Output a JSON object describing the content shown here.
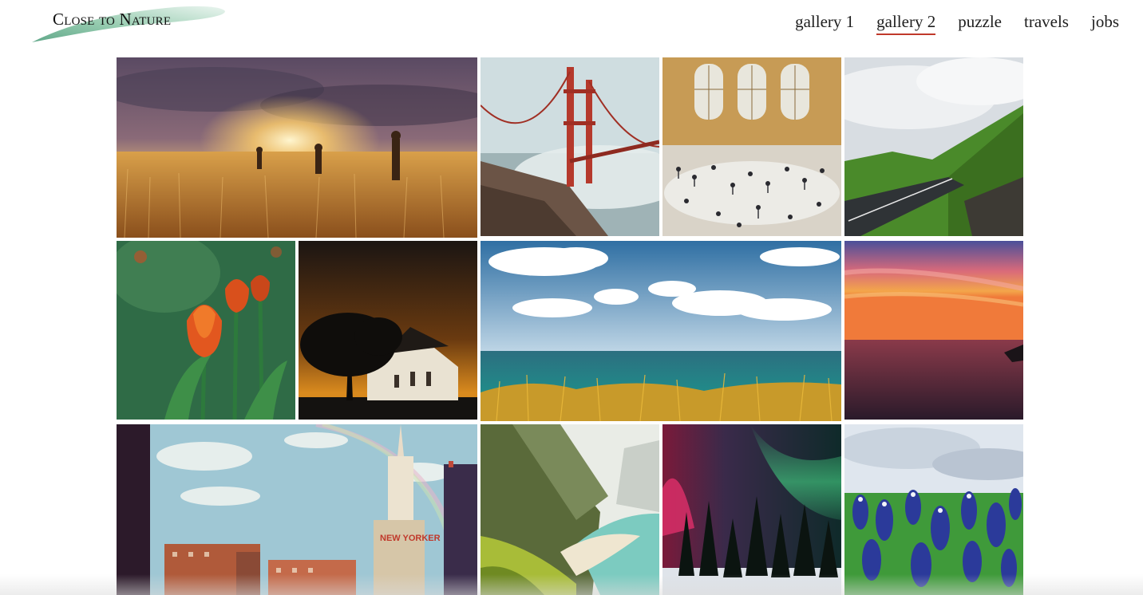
{
  "header": {
    "logo_text": "Close to Nature",
    "nav": [
      {
        "label": "gallery 1",
        "active": false
      },
      {
        "label": "gallery 2",
        "active": true
      },
      {
        "label": "puzzle",
        "active": false
      },
      {
        "label": "travels",
        "active": false
      },
      {
        "label": "jobs",
        "active": false
      }
    ]
  },
  "colors": {
    "active_underline": "#c0392b",
    "logo_brush": "#5fae8a"
  },
  "photo_signs": {
    "skyline_sign": "NEW YORKER"
  }
}
